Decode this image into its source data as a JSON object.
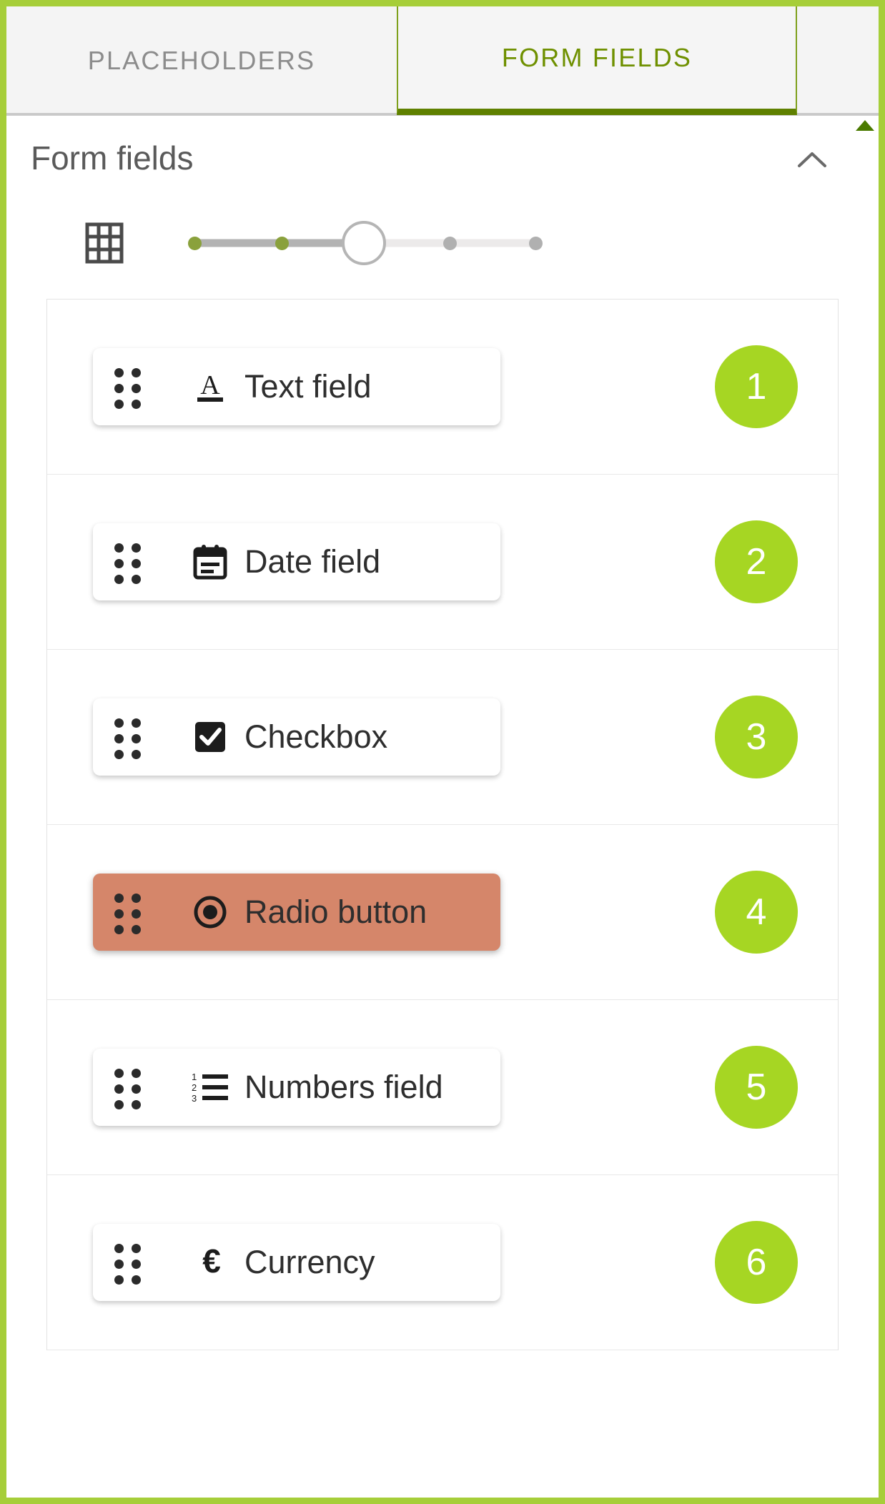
{
  "theme": {
    "brand_green": "#a6ce39",
    "badge_green": "#a6d623",
    "active_tab_green": "#6f9000",
    "selected_row": "#d5866a"
  },
  "tabs": [
    {
      "label": "PLACEHOLDERS",
      "active": false
    },
    {
      "label": "FORM FIELDS",
      "active": true
    }
  ],
  "panel": {
    "title": "Form fields",
    "collapse_icon": "chevron-up-icon",
    "scroll_up_icon": "triangle-up-icon"
  },
  "size_control": {
    "icon": "grid-icon",
    "steps": 5,
    "value": 3,
    "dot_states": [
      "on",
      "on",
      "handle",
      "off",
      "off"
    ]
  },
  "fields": [
    {
      "label": "Text field",
      "icon": "text-format-icon",
      "badge": "1",
      "selected": false
    },
    {
      "label": "Date field",
      "icon": "calendar-icon",
      "badge": "2",
      "selected": false
    },
    {
      "label": "Checkbox",
      "icon": "checkbox-icon",
      "badge": "3",
      "selected": false
    },
    {
      "label": "Radio button",
      "icon": "radio-button-icon",
      "badge": "4",
      "selected": true
    },
    {
      "label": "Numbers field",
      "icon": "numbered-list-icon",
      "badge": "5",
      "selected": false
    },
    {
      "label": "Currency",
      "icon": "euro-icon",
      "badge": "6",
      "selected": false
    }
  ]
}
